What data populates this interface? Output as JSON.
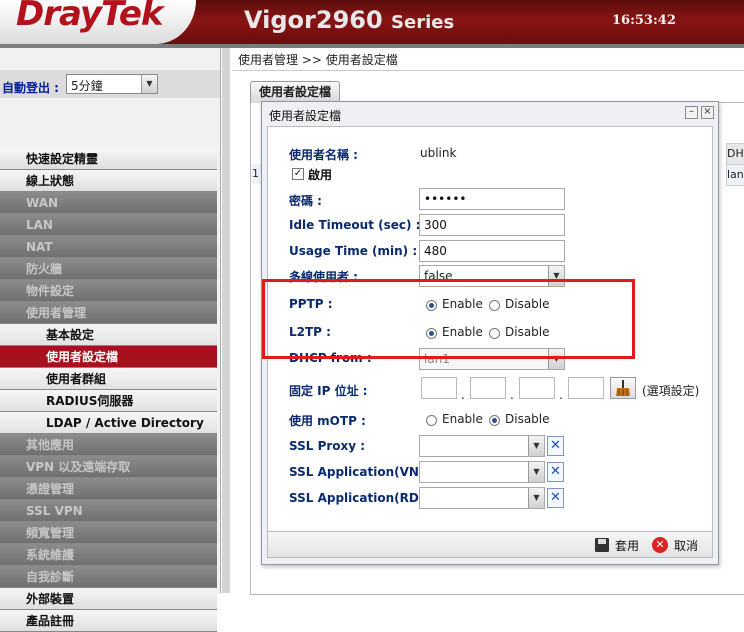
{
  "header": {
    "brand": "DrayTek",
    "model": "Vigor2960",
    "series": "Series",
    "time": "16:53:42"
  },
  "sidebar": {
    "auto_logout_label": "自動登出 :",
    "auto_logout_value": "5分鐘",
    "items": [
      {
        "label": "快速設定精靈",
        "style": "light"
      },
      {
        "label": "線上狀態",
        "style": "light"
      },
      {
        "label": "WAN",
        "style": "dim"
      },
      {
        "label": "LAN",
        "style": "dim"
      },
      {
        "label": "NAT",
        "style": "dim"
      },
      {
        "label": "防火牆",
        "style": "dim"
      },
      {
        "label": "物件設定",
        "style": "dim"
      },
      {
        "label": "使用者管理",
        "style": "dim"
      },
      {
        "label": "基本設定",
        "style": "sub"
      },
      {
        "label": "使用者設定檔",
        "style": "active"
      },
      {
        "label": "使用者群組",
        "style": "sub"
      },
      {
        "label": "RADIUS伺服器",
        "style": "sub"
      },
      {
        "label": "LDAP / Active Directory",
        "style": "sub"
      },
      {
        "label": "其他應用",
        "style": "dim"
      },
      {
        "label": "VPN 以及遠端存取",
        "style": "dim"
      },
      {
        "label": "憑證管理",
        "style": "dim"
      },
      {
        "label": "SSL VPN",
        "style": "dim"
      },
      {
        "label": "頻寬管理",
        "style": "dim"
      },
      {
        "label": "系統維護",
        "style": "dim"
      },
      {
        "label": "自我診斷",
        "style": "dim"
      },
      {
        "label": "外部裝置",
        "style": "light"
      },
      {
        "label": "產品註冊",
        "style": "light"
      }
    ]
  },
  "main": {
    "breadcrumb": "使用者管理 >> 使用者設定檔",
    "tab_label": "使用者設定檔",
    "bg_col_header": "DH",
    "bg_row_num": "1",
    "bg_row_cell": "lan"
  },
  "dialog": {
    "title": "使用者設定檔",
    "minimize_glyph": "–",
    "close_glyph": "×",
    "username_label": "使用者名稱 :",
    "username_value": "ublink",
    "enable_label": "啟用",
    "enable_checked": true,
    "password_label": "密碼 :",
    "password_value": "••••••",
    "idle_label": "Idle Timeout (sec) :",
    "idle_value": "300",
    "usage_label": "Usage Time (min) :",
    "usage_value": "480",
    "multi_label": "多線使用者 :",
    "multi_value": "false",
    "pptp_label": "PPTP :",
    "l2tp_label": "L2TP :",
    "enable_opt": "Enable",
    "disable_opt": "Disable",
    "dhcp_label": "DHCP from :",
    "dhcp_value": "lan1",
    "fixed_ip_label": "固定 IP 位址 :",
    "ip_dot": ".",
    "optional_note": "(選項設定)",
    "motp_label": "使用 mOTP :",
    "ssl_proxy_label": "SSL Proxy :",
    "ssl_vnc_label": "SSL Application(VNC) :",
    "ssl_rdp_label": "SSL Application(RDP) :",
    "clear_glyph": "✕",
    "apply_label": "套用",
    "cancel_label": "取消",
    "cancel_glyph": "✕"
  },
  "colors": {
    "brand_red": "#b2121c",
    "highlight": "#e21a1a",
    "active_menu": "#a6111d",
    "label_blue": "#0a2a6e"
  }
}
